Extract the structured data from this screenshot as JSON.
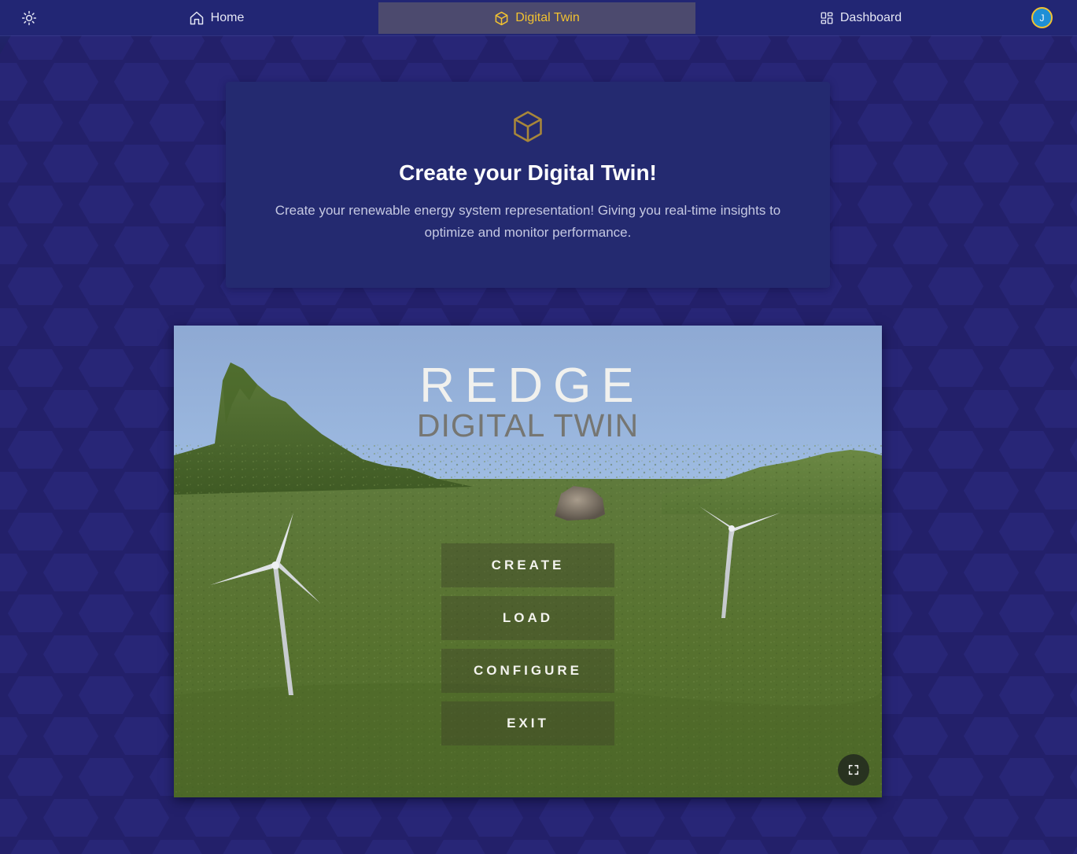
{
  "nav": {
    "theme_icon": "sun-icon",
    "items": [
      {
        "label": "Home",
        "icon": "home-icon"
      },
      {
        "label": "Digital Twin",
        "icon": "cube-icon",
        "active": true
      },
      {
        "label": "Dashboard",
        "icon": "dashboard-grid-icon"
      }
    ],
    "avatar_initial": "J"
  },
  "hero": {
    "icon": "cube-icon",
    "title": "Create your Digital Twin!",
    "description": "Create your renewable energy system representation! Giving you real-time insights to optimize and monitor performance."
  },
  "game": {
    "title": "REDGE",
    "subtitle": "DIGITAL TWIN",
    "menu": [
      "CREATE",
      "LOAD",
      "CONFIGURE",
      "EXIT"
    ],
    "fullscreen_icon": "fullscreen-icon"
  },
  "colors": {
    "background": "#23206a",
    "navbar": "#222674",
    "active_tab": "#4c4a6e",
    "accent": "#f2c230",
    "card": "#242a70"
  }
}
